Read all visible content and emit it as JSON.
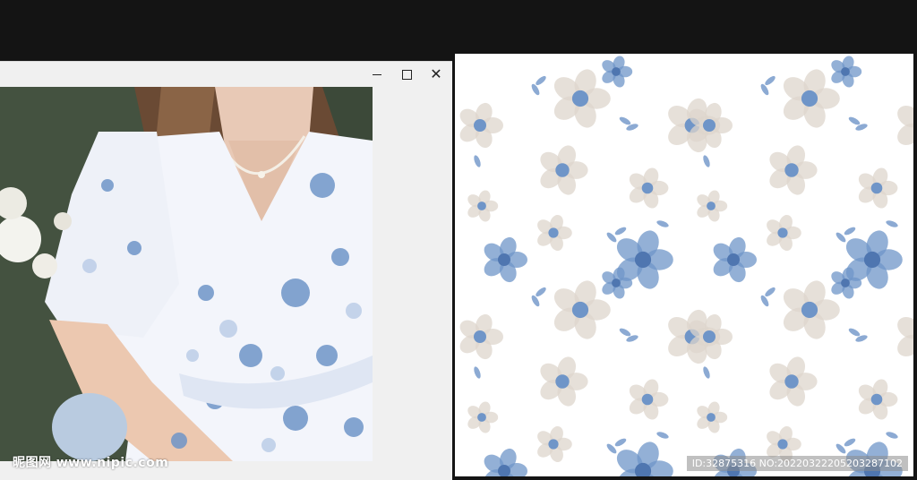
{
  "window": {
    "controls": {
      "minimize": "minimize",
      "maximize": "maximize",
      "close": "close"
    }
  },
  "photo": {
    "description_icon": "dress-photo",
    "watermark_logo": "昵图网 www.nipic.com"
  },
  "pattern": {
    "id_text": "ID:32875316 NO:20220322205203287102"
  },
  "colors": {
    "background": "#141414",
    "window": "#f0f0f0",
    "flower_blue": "#6f95c8",
    "flower_beige": "#ddd6cc"
  }
}
